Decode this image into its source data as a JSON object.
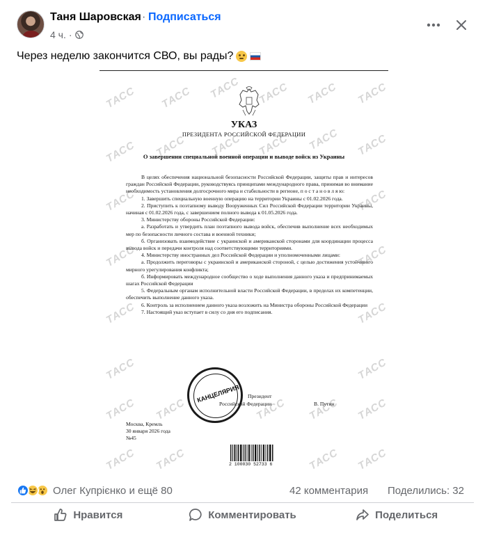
{
  "post": {
    "author": "Таня Шаровская",
    "separator": "·",
    "subscribe_label": "Подписаться",
    "time": "4 ч.",
    "meta_separator": "·",
    "text": "Через неделю закончится СВО, вы рады?",
    "text_emojis": [
      "thinking-face",
      "russia-flag"
    ]
  },
  "document": {
    "watermark": "ТАСС",
    "title": "УКАЗ",
    "issuer": "ПРЕЗИДЕНТА РОССИЙСКОЙ ФЕДЕРАЦИИ",
    "subject": "О завершении специальной военной операции и выводе войск из Украины",
    "paragraphs": [
      "В целях обеспечения национальной безопасности Российской Федерации, защиты прав и интересов граждан Российской Федерации, руководствуясь принципами международного права, принимая во внимание необходимость установления долгосрочного мира и стабильности в регионе, п о с т а н о в л я ю:",
      "1.    Завершить специальную военную операцию на территории Украины с 01.02.2026 года.",
      "2.    Приступить к поэтапному выводу Вооруженных Сил Российской Федерации территории Украины, начиная с 01.02.2026 года, с завершением полного вывода к 01.05.2026 года.",
      "3.    Министерству обороны Российской Федерации:",
      "а. Разработать и утвердить план поэтапного вывода войск, обеспечив выполнение всех необходимых мер по безопасности личного состава и военной техники;",
      "б. Организовать взаимодействие с украинской и американской сторонами для координации процесса вывода войск и передачи контроля над соответствующими территориями.",
      "4.    Министерству иностранных дел Российской Федерации и уполномоченными лицами:",
      "а. Продолжить переговоры с украинской и американской стороной, с целью достижения устойчивого мирного урегулирования конфликта;",
      "б. Информировать международное сообщество о ходе выполнения данного указа и предпринимаемых шагах Российской Федерации",
      "5.    Федеральным органам исполнительной власти Российской Федерации, в пределах их компетенции, обеспечить выполнение данного указа.",
      "6.    Контроль за исполнением данного указа возложить на Министра обороны Российской Федерации",
      "7.    Настоящий указ вступает в силу со дня его подписания."
    ],
    "stamp_text": "КАНЦЕЛЯРИЯ",
    "sign_line1": "Президент",
    "sign_line2": "Российской Федерации",
    "signer": "В. Путин",
    "place": "Москва, Кремль",
    "date": "30 января 2026 года",
    "number": "№45",
    "barcode_number": "2 100030 52733 6"
  },
  "stats": {
    "reactions": [
      "like",
      "haha",
      "wow"
    ],
    "reaction_names": "Олег Купрієнко и ещё 80",
    "comments": "42 комментария",
    "shares": "Поделились: 32"
  },
  "actions": {
    "like": "Нравится",
    "comment": "Комментировать",
    "share": "Поделиться"
  },
  "colors": {
    "link_blue": "#0866ff",
    "secondary_text": "#65676b",
    "like_blue": "#1877f2"
  }
}
